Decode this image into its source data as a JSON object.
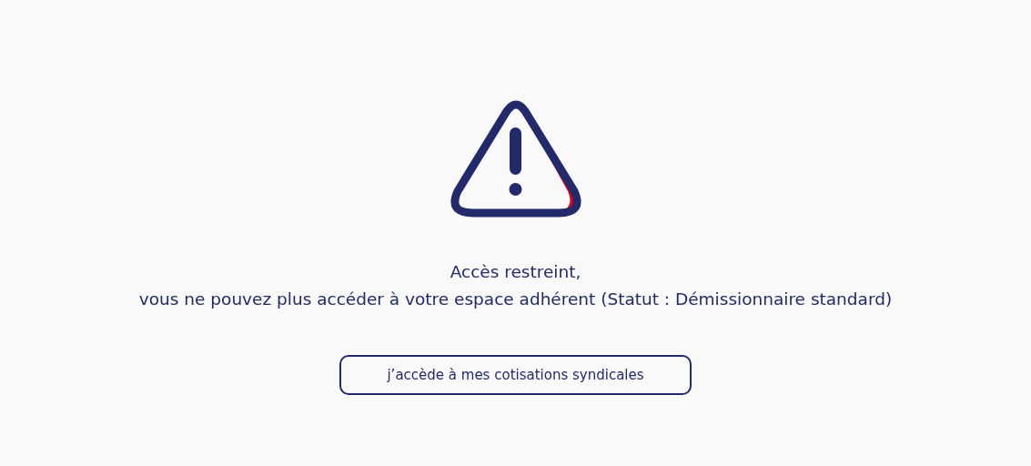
{
  "message": {
    "lines": [
      "Accès restreint,",
      "vous ne pouvez plus accéder à votre espace adhérent (Statut : Démissionnaire standard)"
    ]
  },
  "button": {
    "label": "j’accède à mes cotisations syndicales"
  }
}
